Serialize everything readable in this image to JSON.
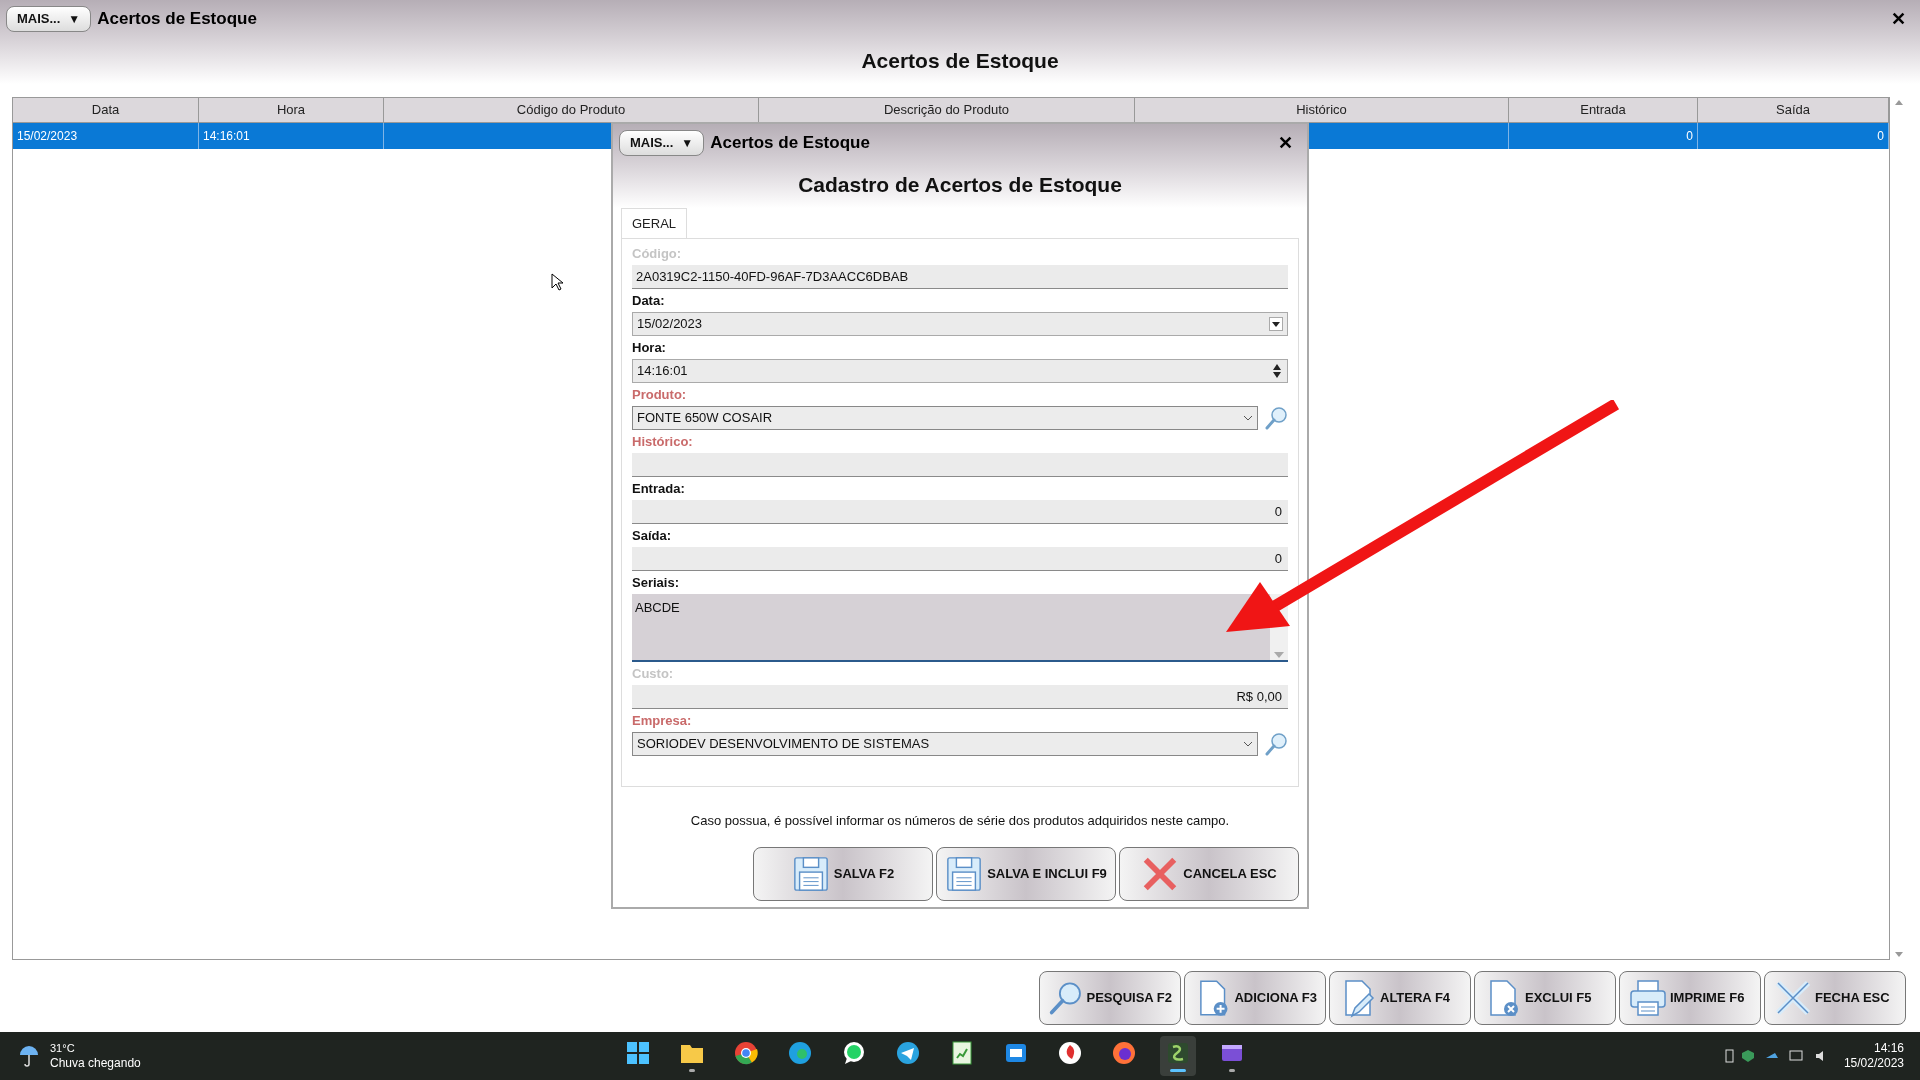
{
  "window": {
    "menu_button": "MAIS...",
    "menu_caret": "▼",
    "title": "Acertos de Estoque",
    "close": "✕",
    "heading": "Acertos de Estoque"
  },
  "table": {
    "columns": [
      "Data",
      "Hora",
      "Código do Produto",
      "Descrição do Produto",
      "Histórico",
      "Entrada",
      "Saída"
    ],
    "rows": [
      {
        "selected": true,
        "cells": [
          "15/02/2023",
          "14:16:01",
          "",
          "",
          "",
          "0",
          "0"
        ]
      }
    ]
  },
  "toolbar": [
    {
      "kind": "search",
      "label": "PESQUISA F2"
    },
    {
      "kind": "add",
      "label": "ADICIONA F3"
    },
    {
      "kind": "edit",
      "label": "ALTERA F4"
    },
    {
      "kind": "delete",
      "label": "EXCLUI F5"
    },
    {
      "kind": "print",
      "label": "IMPRIME F6"
    },
    {
      "kind": "close",
      "label": "FECHA ESC"
    }
  ],
  "dialog": {
    "menu_button": "MAIS...",
    "menu_caret": "▼",
    "title": "Acertos de Estoque",
    "close": "✕",
    "heading": "Cadastro de Acertos de Estoque",
    "tabs": [
      {
        "label": "GERAL",
        "selected": true
      }
    ],
    "fields": [
      {
        "kind": "text",
        "label": "Código:",
        "disabled": true,
        "numeric": false,
        "value": "2A0319C2-1150-40FD-96AF-7D3AACC6DBAB"
      },
      {
        "kind": "date",
        "label": "Data:",
        "disabled": false,
        "required": false,
        "value": "15/02/2023"
      },
      {
        "kind": "spinner",
        "label": "Hora:",
        "disabled": false,
        "required": false,
        "value": "14:16:01"
      },
      {
        "kind": "lookup",
        "label": "Produto:",
        "disabled": false,
        "required": true,
        "value": "FONTE 650W COSAIR"
      },
      {
        "kind": "text",
        "label": "Histórico:",
        "disabled": false,
        "required": true,
        "numeric": false
      },
      {
        "kind": "text",
        "label": "Entrada:",
        "disabled": false,
        "required": false,
        "numeric": true,
        "value": "0"
      },
      {
        "kind": "text",
        "label": "Saída:",
        "disabled": false,
        "required": false,
        "numeric": true,
        "value": "0"
      },
      {
        "kind": "textarea",
        "label": "Seriais:",
        "disabled": false,
        "required": false,
        "value": "ABCDE",
        "focused": true
      },
      {
        "kind": "text",
        "label": "Custo:",
        "disabled": true,
        "numeric": true,
        "value": "R$ 0,00"
      },
      {
        "kind": "lookup",
        "label": "Empresa:",
        "disabled": false,
        "required": true,
        "value": "SORIODEV DESENVOLVIMENTO DE SISTEMAS"
      }
    ],
    "hint": "Caso possua, é possível informar os números de série dos produtos adquiridos neste campo.",
    "buttons": [
      {
        "kind": "save",
        "label": "SALVA F2"
      },
      {
        "kind": "save",
        "label": "SALVA E INCLUI F9"
      },
      {
        "kind": "cancel",
        "label": "CANCELA ESC"
      }
    ]
  },
  "taskbar": {
    "weather": {
      "temperature": "31°C",
      "condition": "Chuva chegando"
    },
    "apps": [
      {
        "kind": "start",
        "running": false,
        "selected": false
      },
      {
        "kind": "folder",
        "running": true,
        "selected": false
      },
      {
        "kind": "chrome",
        "running": false,
        "selected": false
      },
      {
        "kind": "edge",
        "running": false,
        "selected": false
      },
      {
        "kind": "chat",
        "running": false,
        "selected": false
      },
      {
        "kind": "telegram",
        "running": false,
        "selected": false
      },
      {
        "kind": "sheet",
        "running": false,
        "selected": false
      },
      {
        "kind": "mail",
        "running": false,
        "selected": false
      },
      {
        "kind": "shield",
        "running": false,
        "selected": false
      },
      {
        "kind": "firefox",
        "running": false,
        "selected": false
      },
      {
        "kind": "app",
        "running": true,
        "selected": true
      },
      {
        "kind": "video",
        "running": true,
        "selected": false
      }
    ],
    "time": "14:16",
    "date": "15/02/2023"
  }
}
